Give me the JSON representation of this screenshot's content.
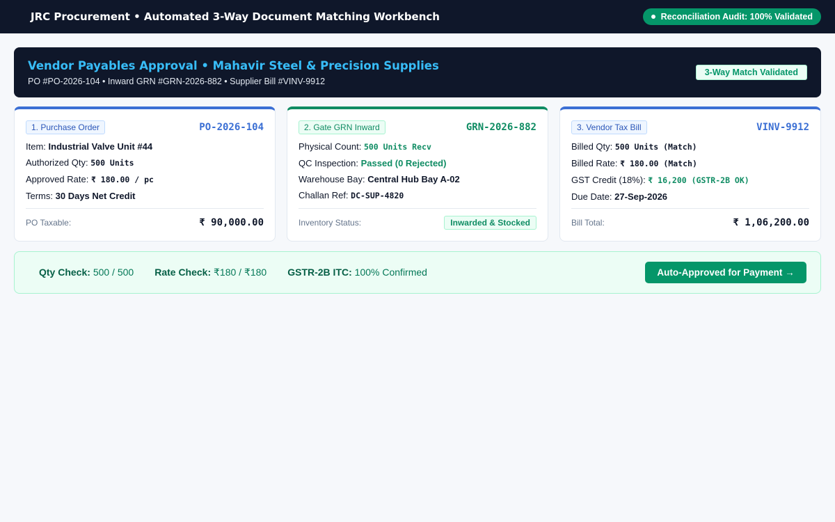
{
  "topbar": {
    "title": "JRC Procurement • Automated 3-Way Document Matching Workbench",
    "audit_status": "Reconciliation Audit: 100% Validated"
  },
  "header": {
    "title": "Vendor Payables Approval • Mahavir Steel & Precision Supplies",
    "subtitle": "PO #PO-2026-104 • Inward GRN #GRN-2026-882 • Supplier Bill #VINV-9912",
    "badge": "3-Way Match Validated"
  },
  "cards": {
    "po": {
      "tag": "1. Purchase Order",
      "doc_id": "PO-2026-104",
      "rows": [
        {
          "label": "Item: ",
          "value": "Industrial Valve Unit #44"
        },
        {
          "label": "Authorized Qty: ",
          "value": "500 Units"
        },
        {
          "label": "Approved Rate: ",
          "value": "₹ 180.00 / pc"
        },
        {
          "label": "Terms: ",
          "value": "30 Days Net Credit"
        }
      ],
      "footer_label": "PO Taxable:",
      "footer_value": "₹ 90,000.00"
    },
    "grn": {
      "tag": "2. Gate GRN Inward",
      "doc_id": "GRN-2026-882",
      "rows": [
        {
          "label": "Physical Count: ",
          "value": "500 Units Recv"
        },
        {
          "label": "QC Inspection: ",
          "value": "Passed (0 Rejected)"
        },
        {
          "label": "Warehouse Bay: ",
          "value": "Central Hub Bay A-02"
        },
        {
          "label": "Challan Ref: ",
          "value": "DC-SUP-4820"
        }
      ],
      "footer_label": "Inventory Status:",
      "footer_value": "Inwarded & Stocked"
    },
    "bill": {
      "tag": "3. Vendor Tax Bill",
      "doc_id": "VINV-9912",
      "rows": [
        {
          "label": "Billed Qty: ",
          "value": "500 Units (Match)"
        },
        {
          "label": "Billed Rate: ",
          "value": "₹ 180.00 (Match)"
        },
        {
          "label": "GST Credit (18%): ",
          "value": "₹ 16,200 (GSTR-2B OK)"
        },
        {
          "label": "Due Date: ",
          "value": "27-Sep-2026"
        }
      ],
      "footer_label": "Bill Total:",
      "footer_value": "₹ 1,06,200.00"
    }
  },
  "summary": {
    "qty_label": "Qty Check:",
    "qty_value": "500 / 500",
    "rate_label": "Rate Check:",
    "rate_value": "₹180 / ₹180",
    "itc_label": "GSTR-2B ITC:",
    "itc_value": "100% Confirmed",
    "approve_button": "Auto-Approved for Payment →"
  },
  "colors": {
    "navy": "#0f172a",
    "accent_blue": "#3b6fd4",
    "accent_green": "#059669",
    "title_cyan": "#38bdf8"
  }
}
